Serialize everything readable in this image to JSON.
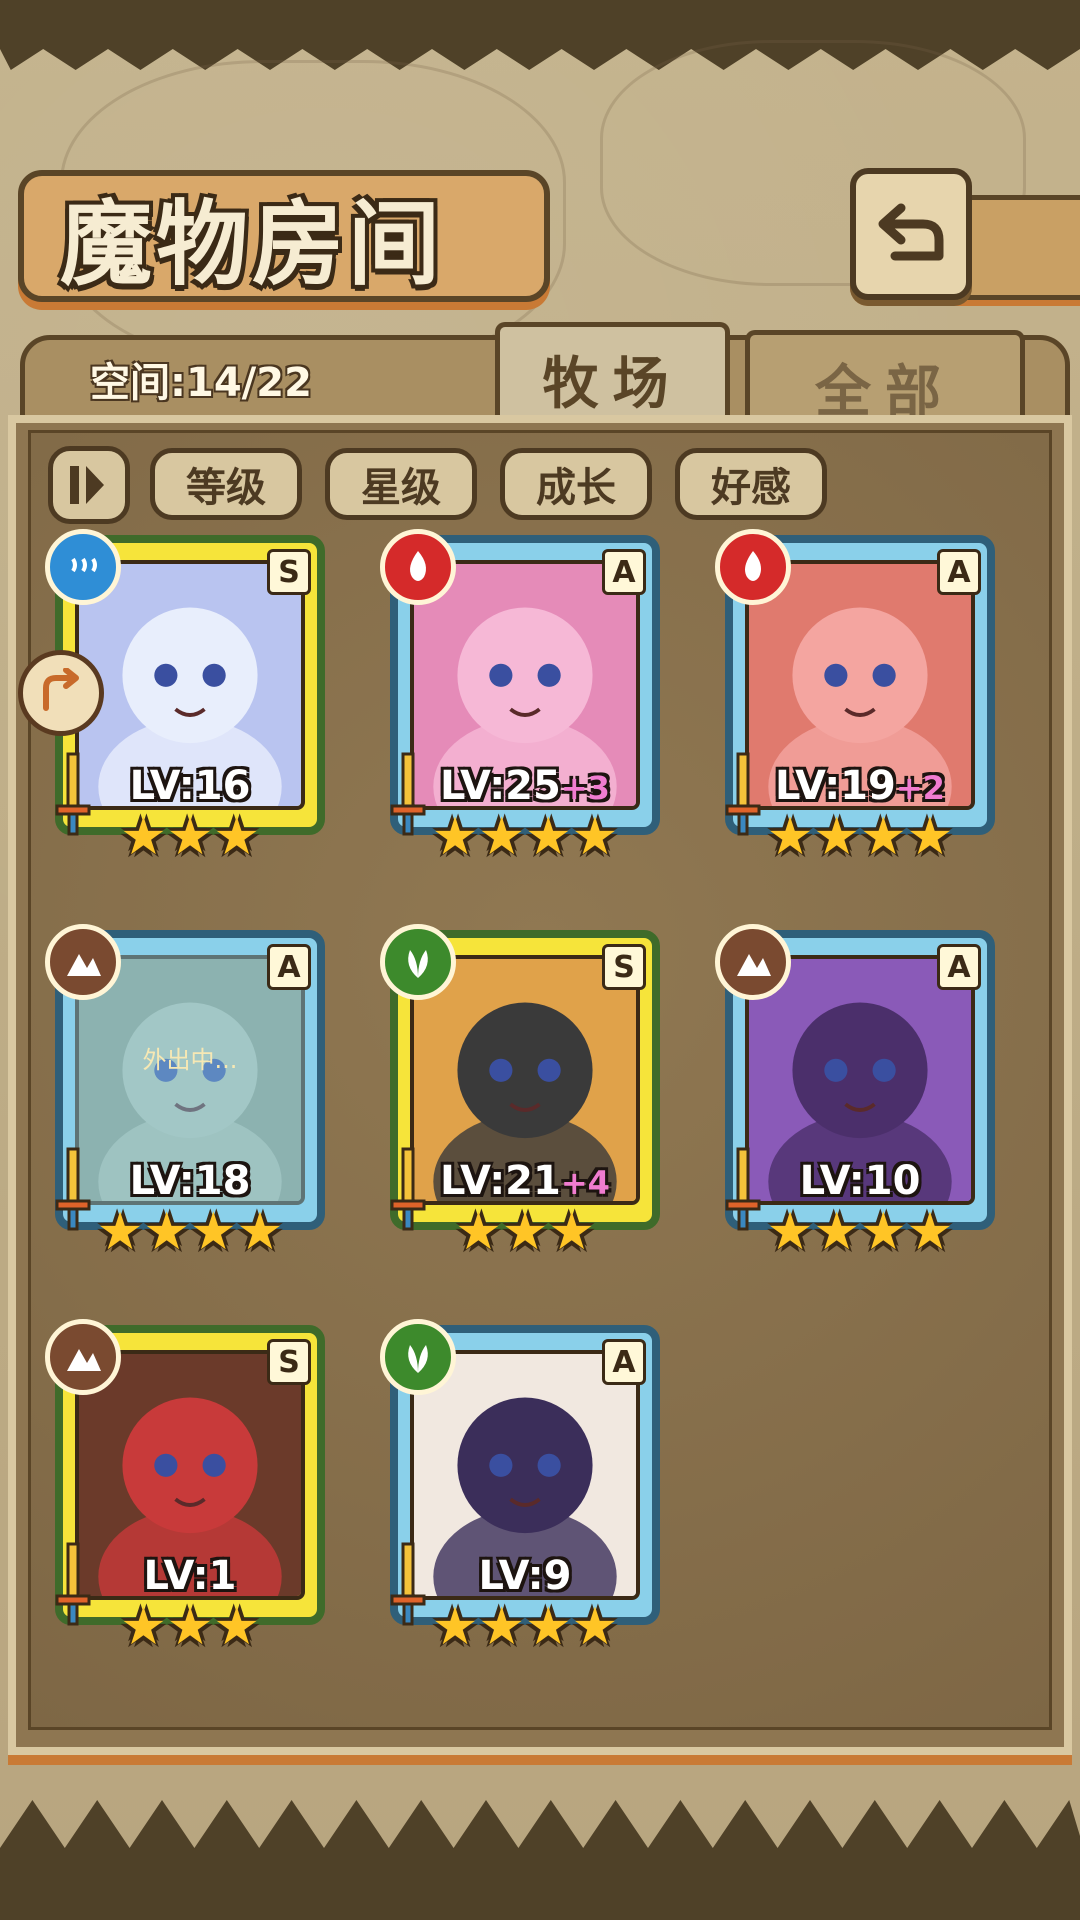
{
  "screen_title": "魔物房间",
  "space": {
    "label": "空间:14/22"
  },
  "tabs": [
    {
      "label": "牧场",
      "active": true
    },
    {
      "label": "全部",
      "active": false
    }
  ],
  "sort_buttons": [
    "等级",
    "星级",
    "成长",
    "好感"
  ],
  "monsters": [
    {
      "level": "LV:16",
      "bonus": "",
      "rank": "S",
      "element": "water",
      "stars": 3,
      "frame": "gold",
      "status": ""
    },
    {
      "level": "LV:25",
      "bonus": "+3",
      "rank": "A",
      "element": "fire",
      "stars": 4,
      "frame": "blue",
      "status": ""
    },
    {
      "level": "LV:19",
      "bonus": "+2",
      "rank": "A",
      "element": "fire",
      "stars": 4,
      "frame": "blue",
      "status": ""
    },
    {
      "level": "LV:18",
      "bonus": "",
      "rank": "A",
      "element": "earth",
      "stars": 4,
      "frame": "blue",
      "status": "外出中..."
    },
    {
      "level": "LV:21",
      "bonus": "+4",
      "rank": "S",
      "element": "wood",
      "stars": 3,
      "frame": "gold",
      "status": ""
    },
    {
      "level": "LV:10",
      "bonus": "",
      "rank": "A",
      "element": "earth",
      "stars": 4,
      "frame": "blue",
      "status": ""
    },
    {
      "level": "LV:1",
      "bonus": "",
      "rank": "S",
      "element": "earth",
      "stars": 3,
      "frame": "gold",
      "status": ""
    },
    {
      "level": "LV:9",
      "bonus": "",
      "rank": "A",
      "element": "wood",
      "stars": 4,
      "frame": "blue",
      "status": ""
    }
  ],
  "colors": {
    "gold_frame": "#f6e43a",
    "blue_frame": "#8ad0ea",
    "panel": "#8e7651"
  }
}
